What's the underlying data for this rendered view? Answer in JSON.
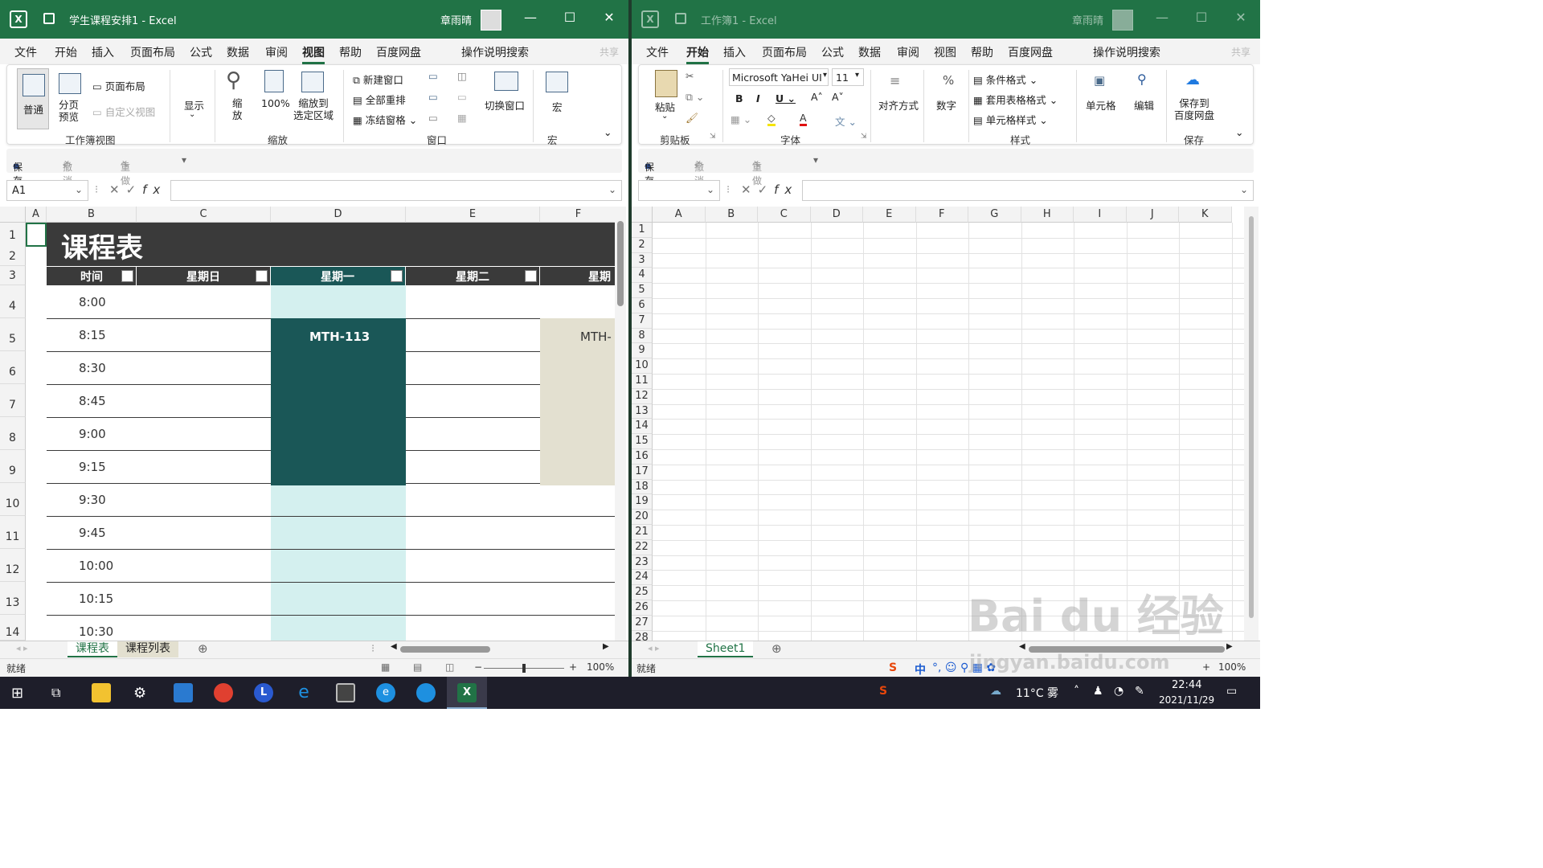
{
  "left": {
    "title": "学生课程安排1 - Excel",
    "user": "章雨晴",
    "tabs": [
      "文件",
      "开始",
      "插入",
      "页面布局",
      "公式",
      "数据",
      "审阅",
      "视图",
      "帮助",
      "百度网盘",
      "操作说明搜索"
    ],
    "active_tab": "视图",
    "share": "共享",
    "ribbon": {
      "normal": "普通",
      "page_break": "分页\n预览",
      "page_layout": "页面布局",
      "custom_view": "自定义视图",
      "workbook_views": "工作簿视图",
      "show": "显示",
      "zoom": "缩\n放",
      "zoom100": "100%",
      "zoom_selection": "缩放到\n选定区域",
      "zoom_group": "缩放",
      "new_window": "新建窗口",
      "arrange_all": "全部重排",
      "freeze": "冻结窗格",
      "window_group": "窗口",
      "switch_window": "切换窗口",
      "macro": "宏",
      "macro_group": "宏"
    },
    "qat": {
      "save": "保存",
      "undo": "撤消",
      "redo": "重做"
    },
    "namebox": "A1",
    "columns": [
      "A",
      "B",
      "C",
      "D",
      "E",
      "F"
    ],
    "rows": [
      "1",
      "2",
      "3",
      "4",
      "5",
      "6",
      "7",
      "8",
      "9",
      "10",
      "11",
      "12",
      "13",
      "14"
    ],
    "sheet_title": "课程表",
    "headers": [
      "时间",
      "星期日",
      "星期一",
      "星期二",
      "星期"
    ],
    "times": [
      "8:00",
      "8:15",
      "8:30",
      "8:45",
      "9:00",
      "9:15",
      "9:30",
      "9:45",
      "10:00",
      "10:15",
      "10:30"
    ],
    "course_mon": "MTH-113",
    "course_wed": "MTH-",
    "sheets": [
      "课程表",
      "课程列表"
    ],
    "status": "就绪",
    "zoom": "100%",
    "colors": {
      "title_band": "#3a3a3a",
      "header_dark": "#3a3a3a",
      "header_mon": "#1a5757",
      "course_mon": "#1a5757",
      "mon_light": "#d4f0ef",
      "course_wed": "#e3e0d0"
    }
  },
  "right": {
    "title": "工作簿1 - Excel",
    "user": "章雨晴",
    "tabs": [
      "文件",
      "开始",
      "插入",
      "页面布局",
      "公式",
      "数据",
      "审阅",
      "视图",
      "帮助",
      "百度网盘",
      "操作说明搜索"
    ],
    "active_tab": "开始",
    "share": "共享",
    "ribbon": {
      "paste": "粘贴",
      "clipboard": "剪贴板",
      "font_name": "Microsoft YaHei UI",
      "font_size": "11",
      "font_group": "字体",
      "align": "对齐方式",
      "number": "数字",
      "cond_format": "条件格式",
      "table_format": "套用表格格式",
      "cell_style": "单元格样式",
      "styles_group": "样式",
      "cells": "单元格",
      "edit": "编辑",
      "save_baidu": "保存到\n百度网盘",
      "save_group": "保存"
    },
    "qat": {
      "save": "保存",
      "undo": "撤消",
      "redo": "重做"
    },
    "namebox": "",
    "columns": [
      "A",
      "B",
      "C",
      "D",
      "E",
      "F",
      "G",
      "H",
      "I",
      "J",
      "K"
    ],
    "rows": [
      "1",
      "2",
      "3",
      "4",
      "5",
      "6",
      "7",
      "8",
      "9",
      "10",
      "11",
      "12",
      "13",
      "14",
      "15",
      "16",
      "17",
      "18",
      "19",
      "20",
      "21",
      "22",
      "23",
      "24",
      "25",
      "26",
      "27",
      "28"
    ],
    "sheets": [
      "Sheet1"
    ],
    "status": "就绪",
    "zoom": "100%"
  },
  "taskbar": {
    "weather": "11°C 雾",
    "time": "22:44",
    "date": "2021/11/29",
    "ime": "中"
  },
  "watermark": {
    "brand": "Bai du 经验",
    "url": "jingyan.baidu.com"
  }
}
